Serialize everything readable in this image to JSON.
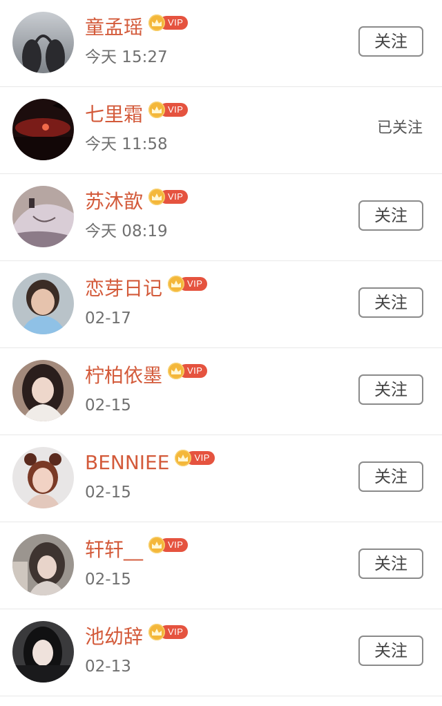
{
  "vip_badge": "VIP",
  "colors": {
    "name": "#d35a3a",
    "vip_red": "#e5533f",
    "vip_gold": "#f4b73a",
    "time": "#707070",
    "divider": "#e8e8e8"
  },
  "users": [
    {
      "name": "童孟瑶",
      "time": "今天 15:27",
      "action": "关注",
      "followed": false
    },
    {
      "name": "七里霜",
      "time": "今天 11:58",
      "action": "已关注",
      "followed": true
    },
    {
      "name": "苏沐歆",
      "time": "今天 08:19",
      "action": "关注",
      "followed": false
    },
    {
      "name": "恋芽日记",
      "time": "02-17",
      "action": "关注",
      "followed": false
    },
    {
      "name": "柠柏依墨",
      "time": "02-15",
      "action": "关注",
      "followed": false
    },
    {
      "name": "BENNIEE",
      "time": "02-15",
      "action": "关注",
      "followed": false
    },
    {
      "name": "轩轩__",
      "time": "02-15",
      "action": "关注",
      "followed": false
    },
    {
      "name": "池幼辞",
      "time": "02-13",
      "action": "关注",
      "followed": false
    }
  ]
}
